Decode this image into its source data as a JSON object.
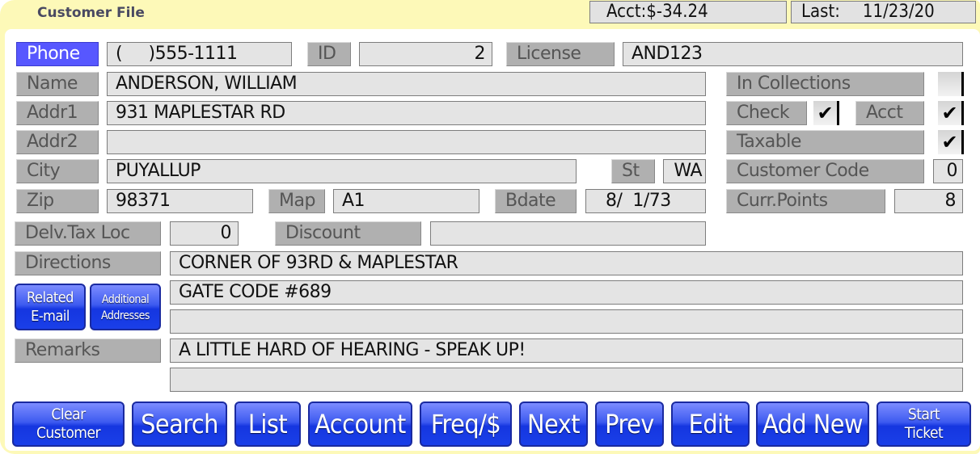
{
  "header": {
    "title": "Customer File",
    "account_balance": "Acct:$-34.24",
    "last_label": "Last:",
    "last_date": "11/23/20"
  },
  "labels": {
    "phone": "Phone",
    "id": "ID",
    "license": "License",
    "name": "Name",
    "addr1": "Addr1",
    "addr2": "Addr2",
    "city": "City",
    "state": "St",
    "zip": "Zip",
    "map": "Map",
    "bdate": "Bdate",
    "in_collections": "In Collections",
    "check": "Check",
    "acct": "Acct",
    "taxable": "Taxable",
    "customer_code": "Customer Code",
    "curr_points": "Curr.Points",
    "delv_tax_loc": "Delv.Tax Loc",
    "discount": "Discount",
    "directions": "Directions",
    "remarks": "Remarks"
  },
  "fields": {
    "phone": "(     )555-1111",
    "id": "2",
    "license": "AND123",
    "name": "ANDERSON, WILLIAM",
    "addr1": "931 MAPLESTAR RD",
    "addr2": "",
    "city": "PUYALLUP",
    "state": "WA",
    "zip": "98371",
    "map": "A1",
    "bdate": "8/  1/73",
    "customer_code": "0",
    "curr_points": "8",
    "delv_tax_loc": "0",
    "discount": "",
    "directions_1": "CORNER OF 93RD & MAPLESTAR",
    "directions_2": "GATE CODE #689",
    "directions_3": "",
    "remarks_1": "A LITTLE HARD OF HEARING - SPEAK UP!",
    "remarks_2": ""
  },
  "checkboxes": {
    "in_collections": "",
    "check": "✔",
    "acct": "✔",
    "taxable": "✔"
  },
  "side_buttons": {
    "related_email_1": "Related",
    "related_email_2": "E-mail",
    "additional_addresses_1": "Additional",
    "additional_addresses_2": "Addresses"
  },
  "buttons": {
    "clear_customer_1": "Clear",
    "clear_customer_2": "Customer",
    "search": "Search",
    "list": "List",
    "account": "Account",
    "freq": "Freq/$",
    "next": "Next",
    "prev": "Prev",
    "edit": "Edit",
    "add_new": "Add New",
    "start_ticket_1": "Start",
    "start_ticket_2": "Ticket"
  }
}
